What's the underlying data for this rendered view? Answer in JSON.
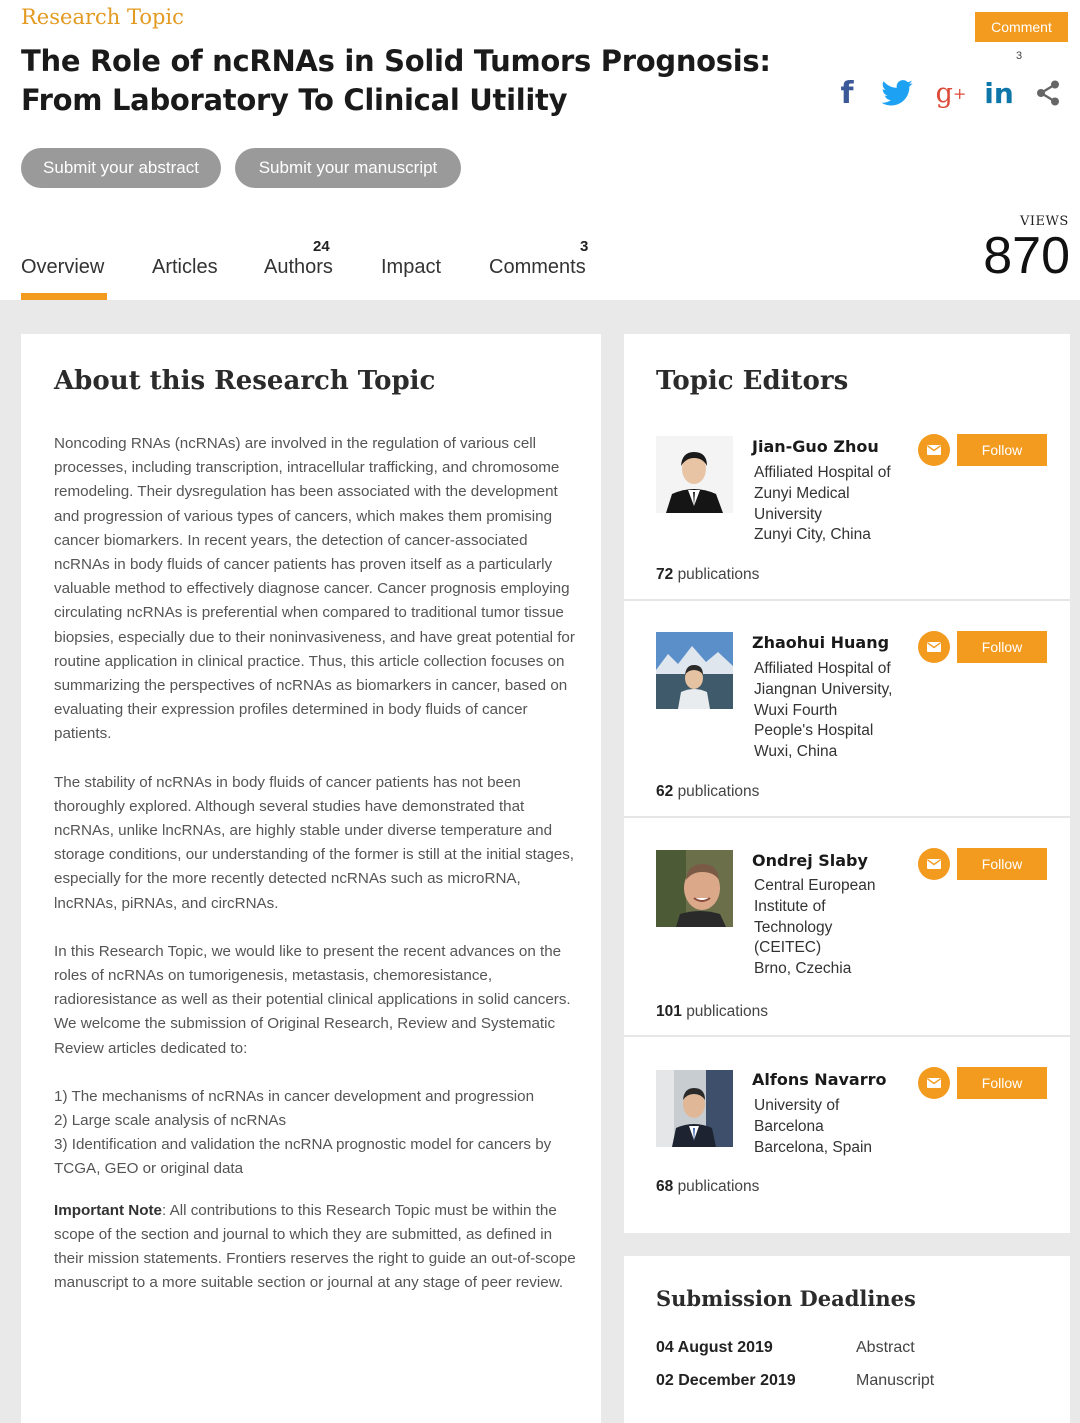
{
  "header": {
    "kicker": "Research Topic",
    "title_line1": "The Role of ncRNAs in Solid Tumors Prognosis:",
    "title_line2": "From Laboratory To Clinical Utility",
    "comment_label": "Comment",
    "comment_count": "3",
    "social": {
      "facebook": "f",
      "google_plus": "g",
      "google_plus_sup": "+",
      "linkedin": "in"
    },
    "submit_abstract": "Submit your abstract",
    "submit_manuscript": "Submit your manuscript",
    "views_label": "VIEWS",
    "views_value": "870"
  },
  "tabs": [
    {
      "label": "Overview",
      "count": ""
    },
    {
      "label": "Articles",
      "count": ""
    },
    {
      "label": "Authors",
      "count": "24"
    },
    {
      "label": "Impact",
      "count": ""
    },
    {
      "label": "Comments",
      "count": "3"
    }
  ],
  "about": {
    "title": "About this Research Topic",
    "p1": "Noncoding RNAs (ncRNAs) are involved in the regulation of various cell processes, including transcription, intracellular trafficking, and chromosome remodeling. Their dysregulation has been associated with the development and progression of various types of cancers, which makes them promising cancer biomarkers. In recent years, the detection of cancer-associated ncRNAs in body fluids of cancer patients has proven itself as a particularly valuable method to effectively diagnose cancer. Cancer prognosis employing circulating ncRNAs is preferential when compared to traditional tumor tissue biopsies, especially due to their noninvasiveness, and have great potential for routine application in clinical practice. Thus, this article collection focuses on summarizing the perspectives of ncRNAs as biomarkers in cancer, based on evaluating their expression profiles determined in body fluids of cancer patients.",
    "p2": "The stability of ncRNAs in body fluids of cancer patients has not been thoroughly explored. Although several studies have demonstrated that ncRNAs, unlike lncRNAs, are highly stable under diverse temperature and storage conditions, our understanding of the former is still at the initial stages, especially for the more recently detected ncRNAs such as microRNA, lncRNAs, piRNAs, and circRNAs.",
    "p3": "In this Research Topic, we would like to present the recent advances on the roles of ncRNAs on tumorigenesis, metastasis, chemoresistance, radioresistance as well as their potential clinical applications in solid cancers. We welcome the submission of Original Research, Review and Systematic Review articles dedicated to:",
    "list": [
      "1) The mechanisms of ncRNAs in cancer development and progression",
      "2) Large scale analysis of ncRNAs",
      "3) Identification and validation the ncRNA prognostic model for cancers by TCGA, GEO or original data"
    ],
    "note_label": "Important Note",
    "note_text": ": All contributions to this Research Topic must be within the scope of the section and journal to which they are submitted, as defined in their mission statements. Frontiers reserves the right to guide an out-of-scope manuscript to a more suitable section or journal at any stage of peer review."
  },
  "editors": {
    "title": "Topic Editors",
    "follow_label": "Follow",
    "publications_suffix": "publications",
    "list": [
      {
        "name": "Jian-Guo Zhou",
        "affiliation": [
          "Affiliated Hospital of",
          "Zunyi Medical",
          "University",
          "Zunyi City, China"
        ],
        "publications": "72"
      },
      {
        "name": "Zhaohui Huang",
        "affiliation": [
          "Affiliated Hospital of",
          "Jiangnan University,",
          "Wuxi Fourth",
          "People's Hospital",
          "Wuxi, China"
        ],
        "publications": "62"
      },
      {
        "name": "Ondrej Slaby",
        "affiliation": [
          "Central European",
          "Institute of",
          "Technology",
          "(CEITEC)",
          "Brno, Czechia"
        ],
        "publications": "101"
      },
      {
        "name": "Alfons Navarro",
        "affiliation": [
          "University of",
          "Barcelona",
          "Barcelona, Spain"
        ],
        "publications": "68"
      }
    ]
  },
  "deadlines": {
    "title": "Submission Deadlines",
    "rows": [
      {
        "date": "04 August 2019",
        "type": "Abstract"
      },
      {
        "date": "02 December 2019",
        "type": "Manuscript"
      }
    ]
  },
  "colors": {
    "accent": "#f39b1f",
    "kicker": "#e39a20",
    "facebook": "#3b5998",
    "twitter": "#1da1f2",
    "google_plus": "#dc4a38",
    "linkedin": "#0e76a8",
    "submit_button": "#9a9a9a",
    "page_background": "#e9e9e9"
  }
}
